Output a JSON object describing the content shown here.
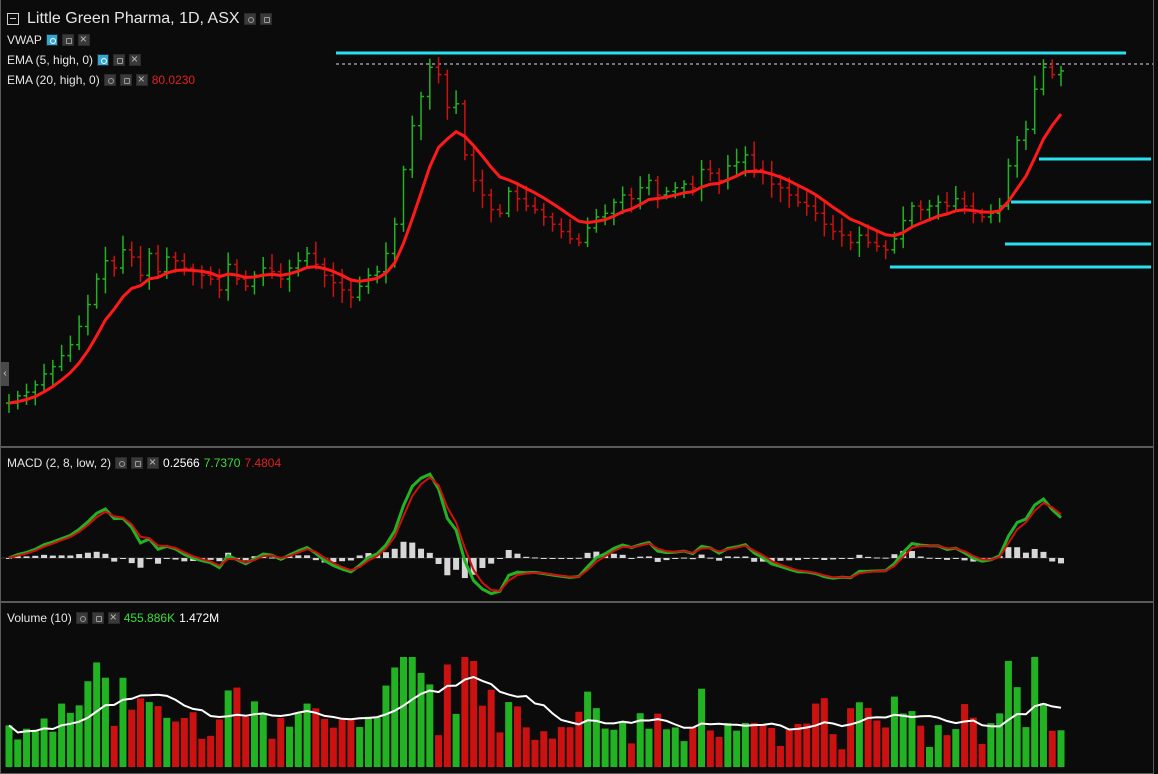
{
  "chart_title": "Little Green Pharma, 1D, ASX",
  "indicators": {
    "vwap": {
      "label": "VWAP"
    },
    "ema5": {
      "label": "EMA (5, high, 0)"
    },
    "ema20": {
      "label": "EMA (20, high, 0)",
      "value": "80.0230"
    }
  },
  "macd": {
    "label": "MACD (2, 8, low, 2)",
    "hist_value": "0.2566",
    "macd_value": "7.7370",
    "signal_value": "7.4804"
  },
  "volume": {
    "label": "Volume (10)",
    "value": "455.886K",
    "ma_value": "1.472M"
  },
  "colors": {
    "background": "#0b0b0b",
    "up": "#22b322",
    "down": "#cc1111",
    "ema": "#ff1a1a",
    "level_line": "#29e0f0",
    "macd_line": "#22b322",
    "signal_line": "#d01010",
    "histogram": "#d6d6d6",
    "volume_ma": "#ffffff"
  },
  "icons": {
    "collapse": "collapse-box-icon",
    "visibility": "eye-icon",
    "settings": "gear-icon",
    "remove": "close-icon",
    "scroll_left": "chevron-left-icon"
  },
  "chart_data": {
    "type": "ohlc",
    "title": "Little Green Pharma, 1D, ASX",
    "interval": "1D",
    "price_close_relative": [
      0.06,
      0.08,
      0.09,
      0.11,
      0.14,
      0.16,
      0.19,
      0.22,
      0.27,
      0.33,
      0.4,
      0.45,
      0.43,
      0.48,
      0.46,
      0.41,
      0.47,
      0.42,
      0.46,
      0.45,
      0.43,
      0.42,
      0.41,
      0.4,
      0.37,
      0.44,
      0.4,
      0.38,
      0.41,
      0.43,
      0.42,
      0.4,
      0.43,
      0.45,
      0.47,
      0.44,
      0.41,
      0.39,
      0.37,
      0.35,
      0.38,
      0.41,
      0.42,
      0.47,
      0.55,
      0.7,
      0.82,
      0.9,
      0.98,
      0.96,
      0.87,
      0.88,
      0.74,
      0.67,
      0.63,
      0.59,
      0.58,
      0.64,
      0.62,
      0.6,
      0.59,
      0.57,
      0.55,
      0.53,
      0.51,
      0.5,
      0.54,
      0.57,
      0.58,
      0.61,
      0.63,
      0.62,
      0.65,
      0.67,
      0.63,
      0.64,
      0.65,
      0.66,
      0.65,
      0.7,
      0.69,
      0.67,
      0.71,
      0.72,
      0.74,
      0.7,
      0.69,
      0.66,
      0.65,
      0.63,
      0.61,
      0.6,
      0.58,
      0.55,
      0.53,
      0.52,
      0.5,
      0.52,
      0.5,
      0.49,
      0.48,
      0.51,
      0.56,
      0.6,
      0.59,
      0.6,
      0.61,
      0.6,
      0.62,
      0.6,
      0.58,
      0.57,
      0.58,
      0.6,
      0.71,
      0.78,
      0.81,
      0.92,
      0.98,
      0.96,
      0.97
    ],
    "levels": [
      "level-1",
      "level-2",
      "level-3",
      "level-4",
      "level-5"
    ],
    "macd_series": "macd",
    "signal_series": "signal",
    "volume_series": "volume"
  }
}
